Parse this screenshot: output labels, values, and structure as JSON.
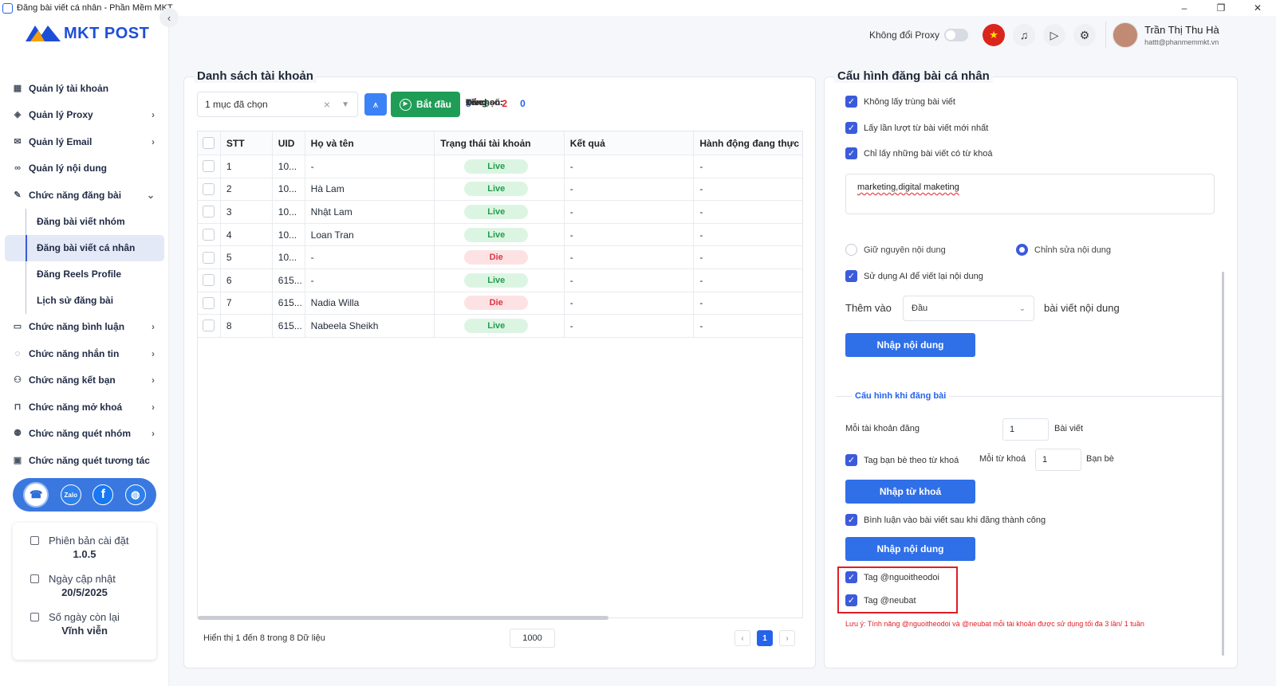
{
  "window": {
    "title": "Đăng bài viết cá nhân - Phần Mềm MKT",
    "controls": [
      "–",
      "❐",
      "✕"
    ]
  },
  "sidebar": {
    "logo_text": "MKT POST",
    "collapse_icon": "chevron-left-icon",
    "items": [
      {
        "label": "Quản lý tài khoản",
        "icon": "grid-icon",
        "chevron": ""
      },
      {
        "label": "Quản lý Proxy",
        "icon": "layers-icon",
        "chevron": "›"
      },
      {
        "label": "Quản lý Email",
        "icon": "mail-icon",
        "chevron": "›"
      },
      {
        "label": "Quản lý nội dung",
        "icon": "link-icon",
        "chevron": ""
      },
      {
        "label": "Chức năng đăng bài",
        "icon": "edit-icon",
        "chevron": "⌄"
      }
    ],
    "sub_items": [
      {
        "label": "Đăng bài viết nhóm",
        "active": false
      },
      {
        "label": "Đăng bài viết cá nhân",
        "active": true
      },
      {
        "label": "Đăng Reels Profile",
        "active": false
      },
      {
        "label": "Lịch sử đăng bài",
        "active": false
      }
    ],
    "items_after": [
      {
        "label": "Chức năng bình luận",
        "icon": "comment-icon",
        "chevron": "›"
      },
      {
        "label": "Chức năng nhắn tin",
        "icon": "chat-icon",
        "chevron": "›"
      },
      {
        "label": "Chức năng kết bạn",
        "icon": "user-plus-icon",
        "chevron": "›"
      },
      {
        "label": "Chức năng mở khoá",
        "icon": "lock-icon",
        "chevron": "›"
      },
      {
        "label": "Chức năng quét nhóm",
        "icon": "users-icon",
        "chevron": "›"
      },
      {
        "label": "Chức năng quét tương tác",
        "icon": "scan-icon",
        "chevron": ""
      }
    ],
    "social": {
      "zalo_label": "Zalo",
      "facebook_label": "f"
    },
    "info": {
      "version_label": "Phiên bản cài đặt",
      "version_value": "1.0.5",
      "update_label": "Ngày cập nhật",
      "update_value": "20/5/2025",
      "days_label": "Số ngày còn lại",
      "days_value": "Vĩnh viễn"
    }
  },
  "header": {
    "proxy_label": "Không đổi Proxy",
    "proxy_toggle": false,
    "user_name": "Trần Thị Thu Hà",
    "user_email": "hattt@phanmemmkt.vn"
  },
  "accounts": {
    "title": "Danh sách tài khoản",
    "select_value": "1 mục đã chọn",
    "start_label": "Bắt đầu",
    "stats": {
      "total_label": "Tổng số:",
      "total": "8",
      "live_label": "Live:",
      "live": "6",
      "die_label": "Die:",
      "die": "2",
      "selected_label": "Đã chọn:",
      "selected": "0"
    },
    "columns": [
      "STT",
      "UID",
      "Họ và tên",
      "Trạng thái tài khoản",
      "Kết quả",
      "Hành động đang thực h"
    ],
    "rows": [
      {
        "stt": "1",
        "uid": "10...",
        "name": "-",
        "status": "Live",
        "result": "-",
        "action": "-"
      },
      {
        "stt": "2",
        "uid": "10...",
        "name": "Hà Lam",
        "status": "Live",
        "result": "-",
        "action": "-"
      },
      {
        "stt": "3",
        "uid": "10...",
        "name": "Nhật Lam",
        "status": "Live",
        "result": "-",
        "action": "-"
      },
      {
        "stt": "4",
        "uid": "10...",
        "name": "Loan Tran",
        "status": "Live",
        "result": "-",
        "action": "-"
      },
      {
        "stt": "5",
        "uid": "10...",
        "name": "-",
        "status": "Die",
        "result": "-",
        "action": "-"
      },
      {
        "stt": "6",
        "uid": "615...",
        "name": "-",
        "status": "Live",
        "result": "-",
        "action": "-"
      },
      {
        "stt": "7",
        "uid": "615...",
        "name": "Nadia Willa",
        "status": "Die",
        "result": "-",
        "action": "-"
      },
      {
        "stt": "8",
        "uid": "615...",
        "name": "Nabeela Sheikh",
        "status": "Live",
        "result": "-",
        "action": "-"
      }
    ],
    "footer_text": "Hiển thị 1 đến 8 trong 8 Dữ liệu",
    "page_size": "1000",
    "pager": {
      "prev": "‹",
      "current": "1",
      "next": "›"
    }
  },
  "config": {
    "title": "Cấu hình đăng bài cá nhân",
    "opt_no_duplicate": "Không lấy trùng bài viết",
    "opt_newest_first": "Lấy lần lượt từ bài viết mới nhất",
    "opt_keyword_only": "Chỉ lấy những bài viết có từ khoá",
    "keywords": "marketing,digital maketing",
    "radio_keep": "Giữ nguyên nội dung",
    "radio_edit": "Chỉnh sửa nội dung",
    "radio_selected": "edit",
    "opt_ai_rewrite": "Sử dụng AI để viết lại nội dung",
    "add_label": "Thêm vào",
    "add_position": "Đầu",
    "add_tail": "bài viết nội dung",
    "btn_input_content": "Nhập nội dung",
    "section_title": "Cấu hình khi đăng bài",
    "per_account_label": "Mỗi tài khoản đăng",
    "per_account_value": "1",
    "per_account_unit": "Bài viết",
    "opt_tag_friends": "Tag bạn bè theo từ khoá",
    "per_keyword_label": "Mỗi từ khoá",
    "per_keyword_value": "1",
    "per_keyword_unit": "Bạn bè",
    "btn_input_keywords": "Nhập từ khoá",
    "opt_comment_after": "Bình luận vào bài viết sau khi đăng thành công",
    "btn_input_content_2": "Nhập nội dung",
    "opt_tag_follower": "Tag @nguoitheodoi",
    "opt_tag_highlight": "Tag @neubat",
    "note": "Lưu ý: Tính năng @nguoitheodoi và @neubat mỗi tài khoản được sử dụng tối đa 3 lần/ 1 tuần"
  },
  "colors": {
    "accent": "#2f6fe8",
    "start": "#1f9d57",
    "live_bg": "#dcf5e3",
    "die_bg": "#fde2e4",
    "warning": "#e11d26"
  }
}
